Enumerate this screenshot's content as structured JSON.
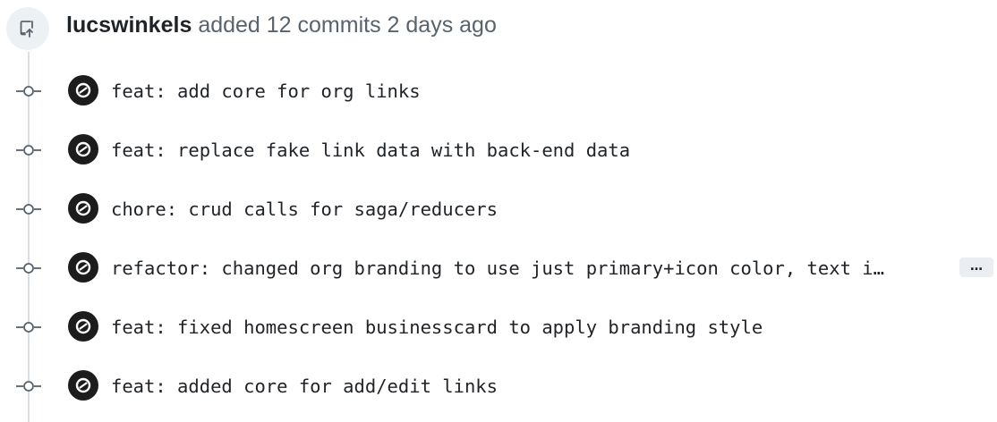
{
  "header": {
    "author": "lucswinkels",
    "action_text": "added 12 commits 2 days ago",
    "icon": "repo-push-icon"
  },
  "commits": [
    {
      "message": "feat: add core for org links"
    },
    {
      "message": "feat: replace fake link data with back-end data"
    },
    {
      "message": "chore: crud calls for saga/reducers"
    },
    {
      "message": "refactor: changed org branding to use just primary+icon color, text i…",
      "truncated": true,
      "expand_label": "…"
    },
    {
      "message": "feat: fixed homescreen businesscard to apply branding style"
    },
    {
      "message": "feat: added core for add/edit links"
    }
  ],
  "colors": {
    "timeline": "#d8dee4",
    "badge_bg": "#eef1f4",
    "avatar_bg": "#1c1c1c",
    "text_primary": "#1f2328",
    "text_secondary": "#59636e"
  }
}
